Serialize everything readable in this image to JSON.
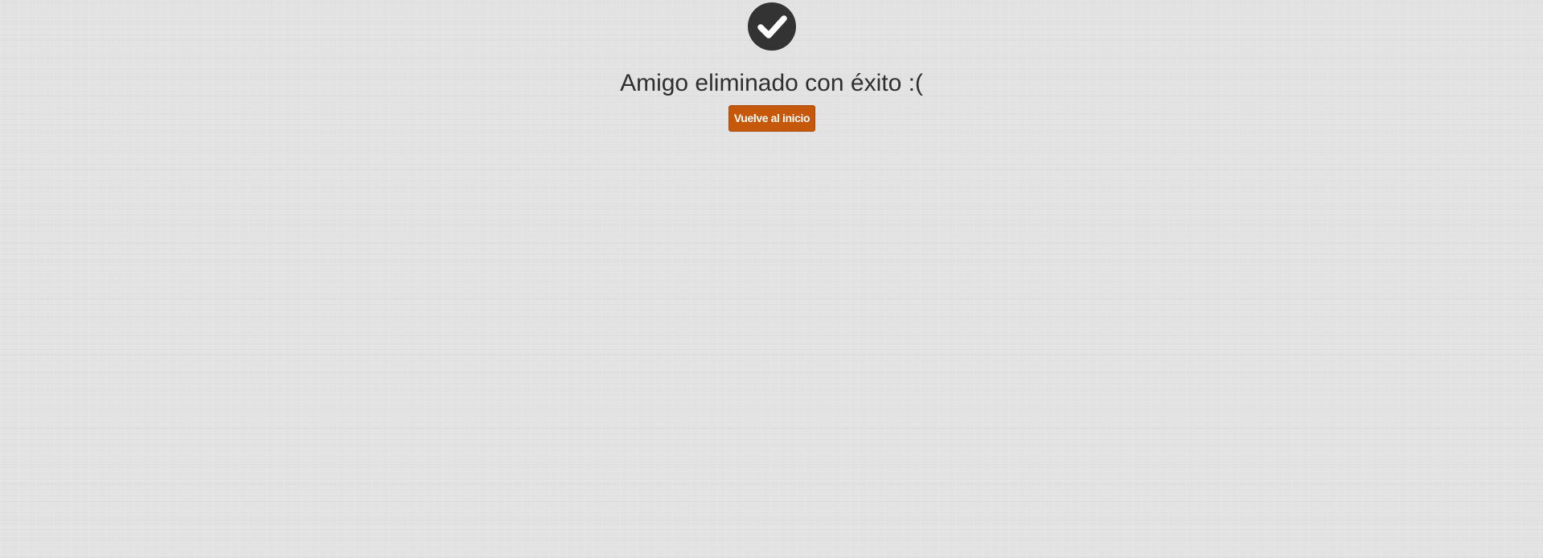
{
  "message": {
    "icon": "check-circle-icon",
    "title": "Amigo eliminado con éxito :("
  },
  "actions": {
    "home_label": "Vuelve al inicio"
  },
  "colors": {
    "background": "#e3e3e3",
    "icon": "#333333",
    "text": "#2f2f2f",
    "button": "#c5580b",
    "button_text": "#ffffff"
  }
}
